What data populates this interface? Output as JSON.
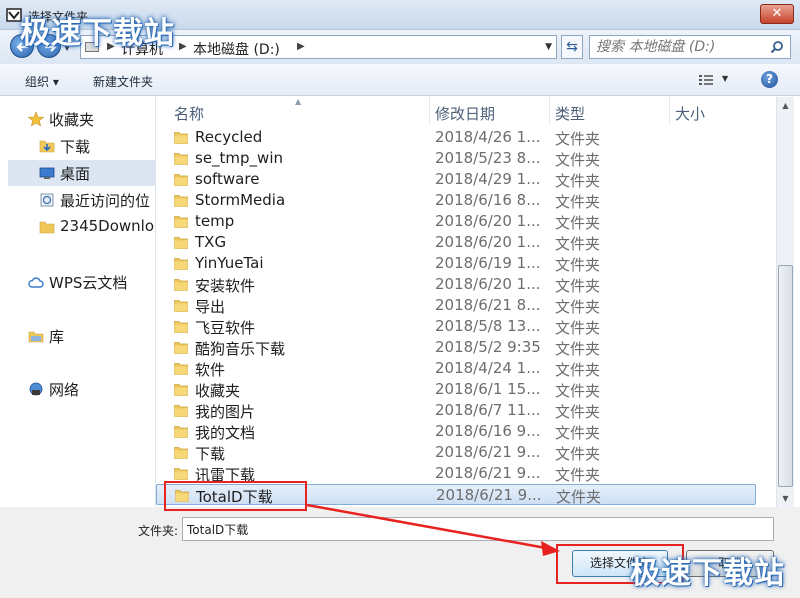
{
  "window": {
    "title": "选择文件夹"
  },
  "nav": {
    "breadcrumbs": [
      "计算机",
      "本地磁盘 (D:)"
    ],
    "search_placeholder": "搜索 本地磁盘 (D:)"
  },
  "toolbar": {
    "organize": "组织 ▾",
    "new_folder": "新建文件夹"
  },
  "sidebar": {
    "items": [
      {
        "label": "收藏夹",
        "icon": "star-icon"
      },
      {
        "label": "下载",
        "icon": "download-folder-icon"
      },
      {
        "label": "桌面",
        "icon": "desktop-icon",
        "selected": true
      },
      {
        "label": "最近访问的位",
        "icon": "recent-places-icon"
      },
      {
        "label": "2345Downlo",
        "icon": "folder-icon"
      },
      {
        "label": "WPS云文档",
        "icon": "cloud-icon"
      },
      {
        "label": "库",
        "icon": "library-icon"
      },
      {
        "label": "网络",
        "icon": "network-icon"
      }
    ]
  },
  "columns": {
    "name": "名称",
    "date": "修改日期",
    "type": "类型",
    "size": "大小"
  },
  "files": [
    {
      "name": "Recycled",
      "date": "2018/4/26 1...",
      "type": "文件夹"
    },
    {
      "name": "se_tmp_win",
      "date": "2018/5/23 8...",
      "type": "文件夹"
    },
    {
      "name": "software",
      "date": "2018/4/29 1...",
      "type": "文件夹"
    },
    {
      "name": "StormMedia",
      "date": "2018/6/16 8...",
      "type": "文件夹"
    },
    {
      "name": "temp",
      "date": "2018/6/20 1...",
      "type": "文件夹"
    },
    {
      "name": "TXG",
      "date": "2018/6/20 1...",
      "type": "文件夹"
    },
    {
      "name": "YinYueTai",
      "date": "2018/6/19 1...",
      "type": "文件夹"
    },
    {
      "name": "安装软件",
      "date": "2018/6/20 1...",
      "type": "文件夹"
    },
    {
      "name": "导出",
      "date": "2018/6/21 8...",
      "type": "文件夹"
    },
    {
      "name": "飞豆软件",
      "date": "2018/5/8 13...",
      "type": "文件夹"
    },
    {
      "name": "酷狗音乐下载",
      "date": "2018/5/2 9:35",
      "type": "文件夹"
    },
    {
      "name": "软件",
      "date": "2018/4/24 1...",
      "type": "文件夹"
    },
    {
      "name": "收藏夹",
      "date": "2018/6/1 15...",
      "type": "文件夹"
    },
    {
      "name": "我的图片",
      "date": "2018/6/7 11...",
      "type": "文件夹"
    },
    {
      "name": "我的文档",
      "date": "2018/6/16 9...",
      "type": "文件夹"
    },
    {
      "name": "下载",
      "date": "2018/6/21 9...",
      "type": "文件夹"
    },
    {
      "name": "讯雷下载",
      "date": "2018/6/21 9...",
      "type": "文件夹"
    },
    {
      "name": "TotalD下载",
      "date": "2018/6/21 9...",
      "type": "文件夹",
      "selected": true
    }
  ],
  "bottom": {
    "folder_label": "文件夹:",
    "folder_value": "TotalD下载",
    "ok_label": "选择文件夹",
    "cancel_label": "取消"
  },
  "watermark": "极速下载站",
  "colors": {
    "highlight_red": "#e8221f",
    "selection": "#cfe0f4",
    "folder": "#f0c85a"
  }
}
